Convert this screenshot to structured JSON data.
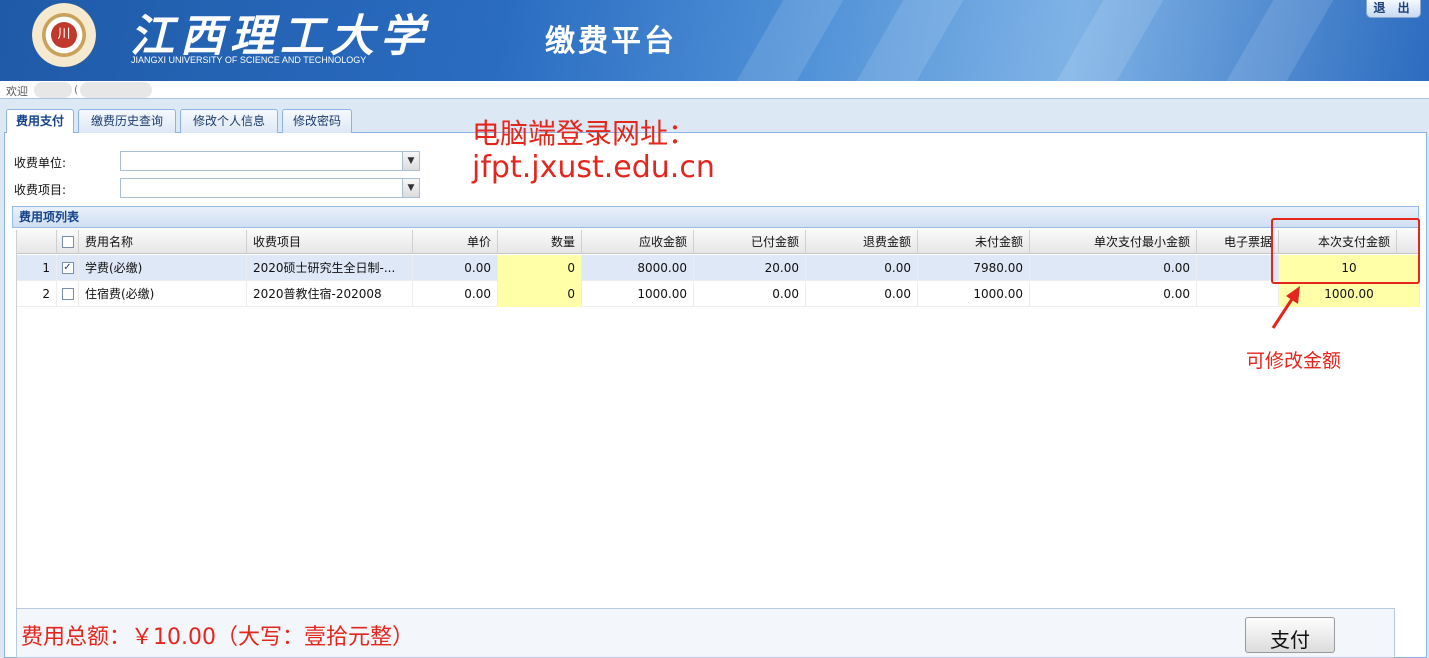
{
  "header": {
    "university_cn": "江西理工大学",
    "university_en": "JIANGXI UNIVERSITY OF SCIENCE AND TECHNOLOGY",
    "logo_glyph": "川",
    "platform_title": "缴费平台",
    "logout_label": "退 出"
  },
  "welcome": {
    "text": "欢迎",
    "paren": "("
  },
  "tabs": [
    {
      "label": "费用支付",
      "active": true
    },
    {
      "label": "缴费历史查询"
    },
    {
      "label": "修改个人信息"
    },
    {
      "label": "修改密码"
    }
  ],
  "form": {
    "unit_label": "收费单位:",
    "item_label": "收费项目:",
    "unit_value": "",
    "item_value": ""
  },
  "annotations": {
    "login_line1": "电脑端登录网址：",
    "login_line2": "jfpt.jxust.edu.cn",
    "modify_amount": "可修改金额"
  },
  "grid": {
    "title": "费用项列表",
    "columns": [
      "费用名称",
      "收费项目",
      "单价",
      "数量",
      "应收金额",
      "已付金额",
      "退费金额",
      "未付金额",
      "单次支付最小金额",
      "电子票据",
      "本次支付金额"
    ],
    "rows": [
      {
        "index": "1",
        "checked": true,
        "name": "学费(必缴)",
        "project": "2020硕士研究生全日制-...",
        "price": "0.00",
        "qty": "0",
        "receivable": "8000.00",
        "paid": "20.00",
        "refund": "0.00",
        "unpaid": "7980.00",
        "min_pay": "0.00",
        "einvoice": "",
        "pay_now": "10"
      },
      {
        "index": "2",
        "checked": false,
        "name": "住宿费(必缴)",
        "project": "2020普教住宿-202008",
        "price": "0.00",
        "qty": "0",
        "receivable": "1000.00",
        "paid": "0.00",
        "refund": "0.00",
        "unpaid": "1000.00",
        "min_pay": "0.00",
        "einvoice": "",
        "pay_now": "1000.00"
      }
    ]
  },
  "summary": {
    "total_text": "费用总额：￥10.00（大写：壹拾元整）",
    "pay_label": "支付"
  },
  "colors": {
    "accent_red": "#e5261d",
    "header_blue": "#2a6cc0",
    "editable_yellow": "#ffffa8"
  }
}
